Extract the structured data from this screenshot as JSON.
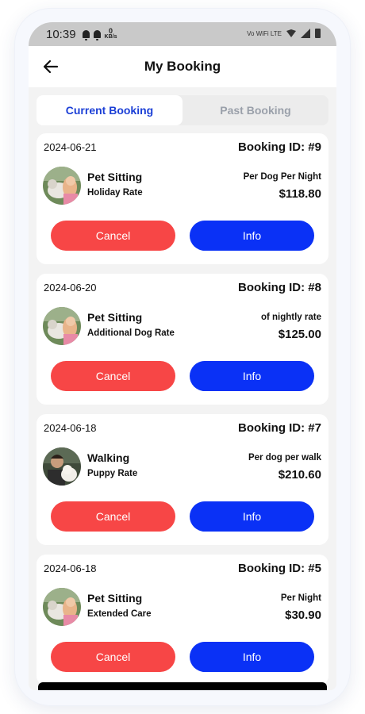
{
  "status_bar": {
    "time": "10:39",
    "speed_value": "0",
    "speed_unit": "KB/s",
    "network": "Vo WiFi LTE"
  },
  "header": {
    "title": "My Booking"
  },
  "tabs": [
    {
      "label": "Current Booking",
      "active": true
    },
    {
      "label": "Past Booking",
      "active": false
    }
  ],
  "colors": {
    "accent": "#1b3fd6",
    "cancel": "#f74646",
    "info": "#0a31f6"
  },
  "bookings": [
    {
      "date": "2024-06-21",
      "booking_id": "Booking ID: #9",
      "service": "Pet Sitting",
      "rate_name": "Holiday Rate",
      "unit": "Per Dog Per Night",
      "price": "$118.80",
      "cancel_label": "Cancel",
      "info_label": "Info"
    },
    {
      "date": "2024-06-20",
      "booking_id": "Booking ID: #8",
      "service": "Pet Sitting",
      "rate_name": "Additional Dog Rate",
      "unit": "of nightly rate",
      "price": "$125.00",
      "cancel_label": "Cancel",
      "info_label": "Info"
    },
    {
      "date": "2024-06-18",
      "booking_id": "Booking ID: #7",
      "service": "Walking",
      "rate_name": "Puppy Rate",
      "unit": "Per dog per walk",
      "price": "$210.60",
      "cancel_label": "Cancel",
      "info_label": "Info"
    },
    {
      "date": "2024-06-18",
      "booking_id": "Booking ID: #5",
      "service": "Pet Sitting",
      "rate_name": "Extended Care",
      "unit": "Per Night",
      "price": "$30.90",
      "cancel_label": "Cancel",
      "info_label": "Info"
    }
  ]
}
